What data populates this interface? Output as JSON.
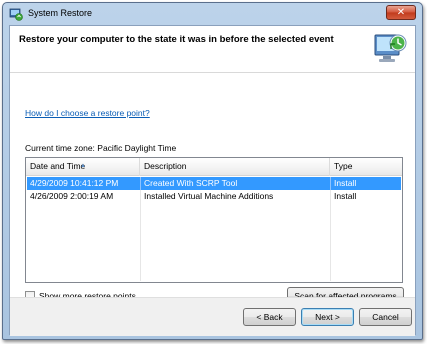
{
  "window": {
    "title": "System Restore",
    "close_glyph": "✕"
  },
  "header": {
    "title": "Restore your computer to the state it was in before the selected event"
  },
  "help_link": "How do I choose a restore point?",
  "timezone_label": "Current time zone: Pacific Daylight Time",
  "table": {
    "columns": [
      "Date and Time",
      "Description",
      "Type"
    ],
    "rows": [
      {
        "date": "4/29/2009 10:41:12 PM",
        "description": "Created With SCRP Tool",
        "type": "Install",
        "selected": true
      },
      {
        "date": "4/26/2009 2:00:19 AM",
        "description": "Installed Virtual Machine Additions",
        "type": "Install",
        "selected": false
      }
    ]
  },
  "show_more_label": "Show more restore points",
  "show_more_checked": false,
  "buttons": {
    "scan": "Scan for affected programs",
    "back": "< Back",
    "next": "Next >",
    "cancel": "Cancel"
  },
  "colors": {
    "selection": "#3399ff",
    "link": "#0a5db5",
    "close_button": "#c8452a"
  }
}
